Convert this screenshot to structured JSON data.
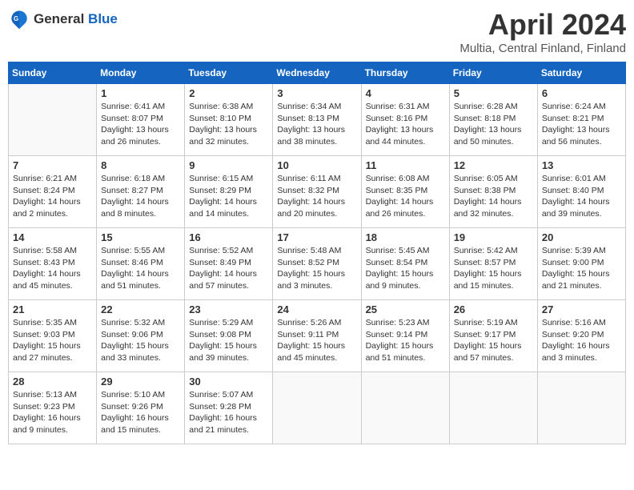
{
  "header": {
    "logo_general": "General",
    "logo_blue": "Blue",
    "title": "April 2024",
    "location": "Multia, Central Finland, Finland"
  },
  "days_of_week": [
    "Sunday",
    "Monday",
    "Tuesday",
    "Wednesday",
    "Thursday",
    "Friday",
    "Saturday"
  ],
  "weeks": [
    [
      {
        "day": "",
        "info": ""
      },
      {
        "day": "1",
        "info": "Sunrise: 6:41 AM\nSunset: 8:07 PM\nDaylight: 13 hours\nand 26 minutes."
      },
      {
        "day": "2",
        "info": "Sunrise: 6:38 AM\nSunset: 8:10 PM\nDaylight: 13 hours\nand 32 minutes."
      },
      {
        "day": "3",
        "info": "Sunrise: 6:34 AM\nSunset: 8:13 PM\nDaylight: 13 hours\nand 38 minutes."
      },
      {
        "day": "4",
        "info": "Sunrise: 6:31 AM\nSunset: 8:16 PM\nDaylight: 13 hours\nand 44 minutes."
      },
      {
        "day": "5",
        "info": "Sunrise: 6:28 AM\nSunset: 8:18 PM\nDaylight: 13 hours\nand 50 minutes."
      },
      {
        "day": "6",
        "info": "Sunrise: 6:24 AM\nSunset: 8:21 PM\nDaylight: 13 hours\nand 56 minutes."
      }
    ],
    [
      {
        "day": "7",
        "info": "Sunrise: 6:21 AM\nSunset: 8:24 PM\nDaylight: 14 hours\nand 2 minutes."
      },
      {
        "day": "8",
        "info": "Sunrise: 6:18 AM\nSunset: 8:27 PM\nDaylight: 14 hours\nand 8 minutes."
      },
      {
        "day": "9",
        "info": "Sunrise: 6:15 AM\nSunset: 8:29 PM\nDaylight: 14 hours\nand 14 minutes."
      },
      {
        "day": "10",
        "info": "Sunrise: 6:11 AM\nSunset: 8:32 PM\nDaylight: 14 hours\nand 20 minutes."
      },
      {
        "day": "11",
        "info": "Sunrise: 6:08 AM\nSunset: 8:35 PM\nDaylight: 14 hours\nand 26 minutes."
      },
      {
        "day": "12",
        "info": "Sunrise: 6:05 AM\nSunset: 8:38 PM\nDaylight: 14 hours\nand 32 minutes."
      },
      {
        "day": "13",
        "info": "Sunrise: 6:01 AM\nSunset: 8:40 PM\nDaylight: 14 hours\nand 39 minutes."
      }
    ],
    [
      {
        "day": "14",
        "info": "Sunrise: 5:58 AM\nSunset: 8:43 PM\nDaylight: 14 hours\nand 45 minutes."
      },
      {
        "day": "15",
        "info": "Sunrise: 5:55 AM\nSunset: 8:46 PM\nDaylight: 14 hours\nand 51 minutes."
      },
      {
        "day": "16",
        "info": "Sunrise: 5:52 AM\nSunset: 8:49 PM\nDaylight: 14 hours\nand 57 minutes."
      },
      {
        "day": "17",
        "info": "Sunrise: 5:48 AM\nSunset: 8:52 PM\nDaylight: 15 hours\nand 3 minutes."
      },
      {
        "day": "18",
        "info": "Sunrise: 5:45 AM\nSunset: 8:54 PM\nDaylight: 15 hours\nand 9 minutes."
      },
      {
        "day": "19",
        "info": "Sunrise: 5:42 AM\nSunset: 8:57 PM\nDaylight: 15 hours\nand 15 minutes."
      },
      {
        "day": "20",
        "info": "Sunrise: 5:39 AM\nSunset: 9:00 PM\nDaylight: 15 hours\nand 21 minutes."
      }
    ],
    [
      {
        "day": "21",
        "info": "Sunrise: 5:35 AM\nSunset: 9:03 PM\nDaylight: 15 hours\nand 27 minutes."
      },
      {
        "day": "22",
        "info": "Sunrise: 5:32 AM\nSunset: 9:06 PM\nDaylight: 15 hours\nand 33 minutes."
      },
      {
        "day": "23",
        "info": "Sunrise: 5:29 AM\nSunset: 9:08 PM\nDaylight: 15 hours\nand 39 minutes."
      },
      {
        "day": "24",
        "info": "Sunrise: 5:26 AM\nSunset: 9:11 PM\nDaylight: 15 hours\nand 45 minutes."
      },
      {
        "day": "25",
        "info": "Sunrise: 5:23 AM\nSunset: 9:14 PM\nDaylight: 15 hours\nand 51 minutes."
      },
      {
        "day": "26",
        "info": "Sunrise: 5:19 AM\nSunset: 9:17 PM\nDaylight: 15 hours\nand 57 minutes."
      },
      {
        "day": "27",
        "info": "Sunrise: 5:16 AM\nSunset: 9:20 PM\nDaylight: 16 hours\nand 3 minutes."
      }
    ],
    [
      {
        "day": "28",
        "info": "Sunrise: 5:13 AM\nSunset: 9:23 PM\nDaylight: 16 hours\nand 9 minutes."
      },
      {
        "day": "29",
        "info": "Sunrise: 5:10 AM\nSunset: 9:26 PM\nDaylight: 16 hours\nand 15 minutes."
      },
      {
        "day": "30",
        "info": "Sunrise: 5:07 AM\nSunset: 9:28 PM\nDaylight: 16 hours\nand 21 minutes."
      },
      {
        "day": "",
        "info": ""
      },
      {
        "day": "",
        "info": ""
      },
      {
        "day": "",
        "info": ""
      },
      {
        "day": "",
        "info": ""
      }
    ]
  ]
}
